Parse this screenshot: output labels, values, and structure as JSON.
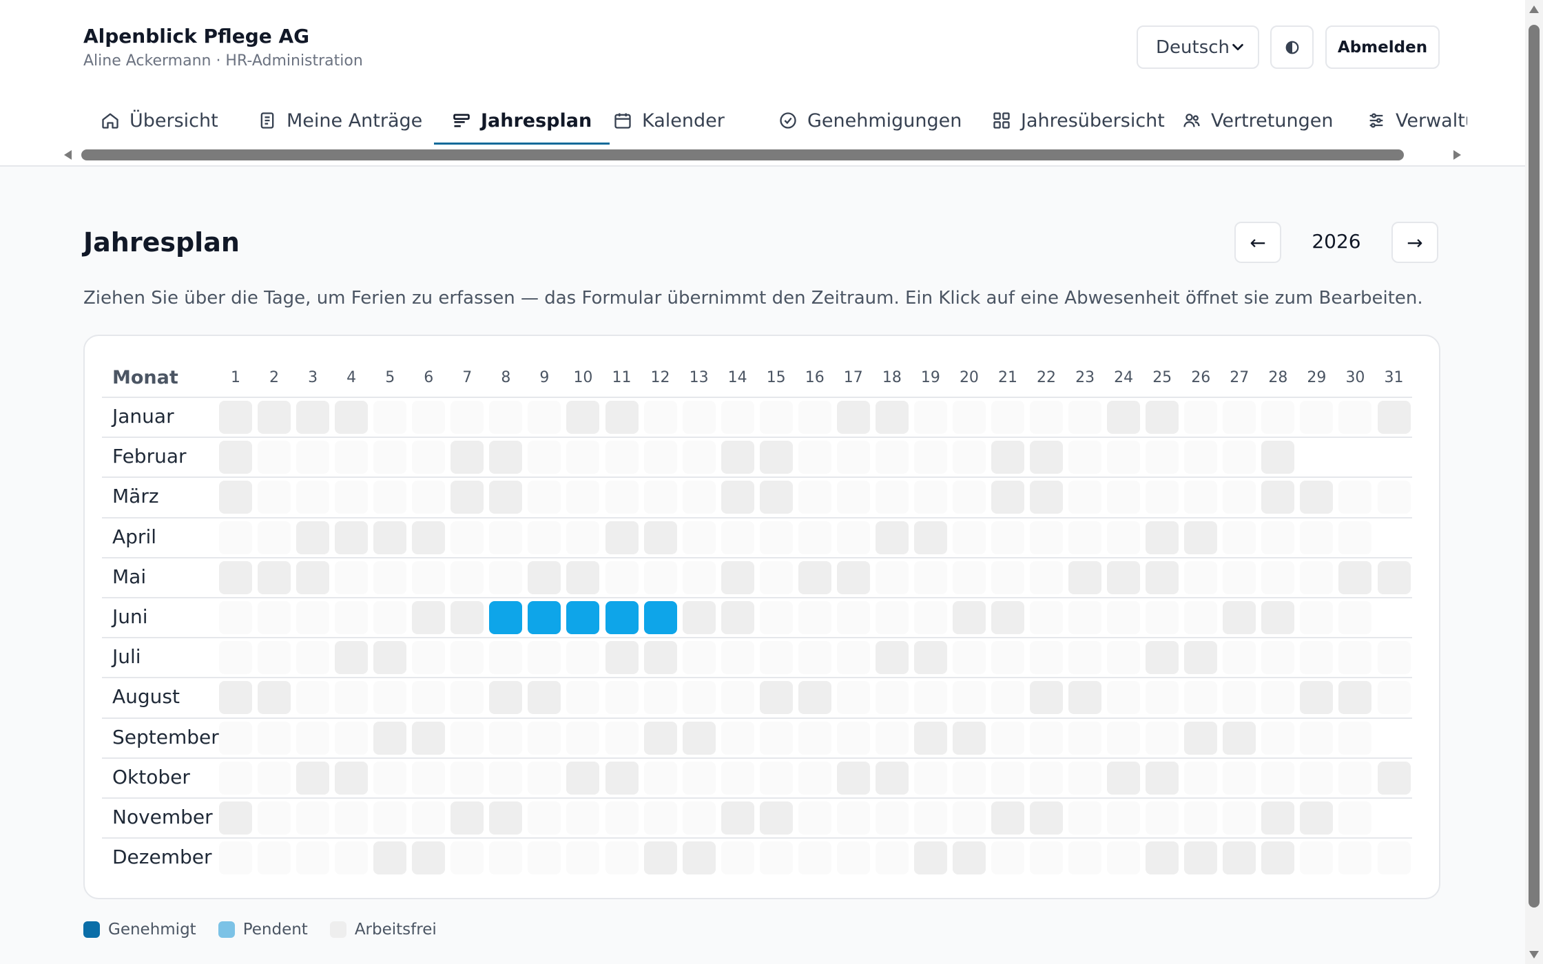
{
  "header": {
    "company": "Alpenblick Pflege AG",
    "user_line": "Aline Ackermann · HR-Administration",
    "language": "Deutsch",
    "logout_label": "Abmelden"
  },
  "tabs": [
    {
      "label": "Übersicht",
      "icon": "home-icon"
    },
    {
      "label": "Meine Anträge",
      "icon": "document-icon"
    },
    {
      "label": "Jahresplan",
      "icon": "timeline-icon",
      "active": true
    },
    {
      "label": "Kalender",
      "icon": "calendar-icon"
    },
    {
      "label": "Genehmigungen",
      "icon": "check-circle-icon"
    },
    {
      "label": "Jahresübersicht",
      "icon": "grid-icon"
    },
    {
      "label": "Vertretungen",
      "icon": "users-icon"
    },
    {
      "label": "Verwaltu",
      "icon": "sliders-icon"
    }
  ],
  "page": {
    "title": "Jahresplan",
    "year": "2026",
    "prev_label": "←",
    "next_label": "→",
    "hint": "Ziehen Sie über die Tage, um Ferien zu erfassen — das Formular übernimmt den Zeitraum. Ein Klick auf eine Abwesenheit öffnet sie zum Bearbeiten."
  },
  "grid": {
    "month_header": "Monat",
    "days": [
      "1",
      "2",
      "3",
      "4",
      "5",
      "6",
      "7",
      "8",
      "9",
      "10",
      "11",
      "12",
      "13",
      "14",
      "15",
      "16",
      "17",
      "18",
      "19",
      "20",
      "21",
      "22",
      "23",
      "24",
      "25",
      "26",
      "27",
      "28",
      "29",
      "30",
      "31"
    ],
    "months": [
      {
        "name": "Januar",
        "length": 31,
        "off": [
          1,
          2,
          3,
          4,
          10,
          11,
          17,
          18,
          24,
          25,
          31
        ],
        "approved": [],
        "pending": []
      },
      {
        "name": "Februar",
        "length": 28,
        "off": [
          1,
          7,
          8,
          14,
          15,
          21,
          22,
          28
        ],
        "approved": [],
        "pending": []
      },
      {
        "name": "März",
        "length": 31,
        "off": [
          1,
          7,
          8,
          14,
          15,
          21,
          22,
          28,
          29
        ],
        "approved": [],
        "pending": []
      },
      {
        "name": "April",
        "length": 30,
        "off": [
          3,
          4,
          5,
          6,
          11,
          12,
          18,
          19,
          25,
          26
        ],
        "approved": [],
        "pending": []
      },
      {
        "name": "Mai",
        "length": 31,
        "off": [
          1,
          2,
          3,
          9,
          10,
          14,
          16,
          17,
          23,
          24,
          25,
          30,
          31
        ],
        "approved": [],
        "pending": []
      },
      {
        "name": "Juni",
        "length": 30,
        "off": [
          6,
          7,
          13,
          14,
          20,
          21,
          27,
          28
        ],
        "approved": [
          8,
          9,
          10,
          11,
          12
        ],
        "pending": []
      },
      {
        "name": "Juli",
        "length": 31,
        "off": [
          4,
          5,
          11,
          12,
          18,
          19,
          25,
          26
        ],
        "approved": [],
        "pending": []
      },
      {
        "name": "August",
        "length": 31,
        "off": [
          1,
          2,
          8,
          9,
          15,
          16,
          22,
          23,
          29,
          30
        ],
        "approved": [],
        "pending": []
      },
      {
        "name": "September",
        "length": 30,
        "off": [
          5,
          6,
          12,
          13,
          19,
          20,
          26,
          27
        ],
        "approved": [],
        "pending": []
      },
      {
        "name": "Oktober",
        "length": 31,
        "off": [
          3,
          4,
          10,
          11,
          17,
          18,
          24,
          25,
          31
        ],
        "approved": [],
        "pending": []
      },
      {
        "name": "November",
        "length": 30,
        "off": [
          1,
          7,
          8,
          14,
          15,
          21,
          22,
          28,
          29
        ],
        "approved": [],
        "pending": []
      },
      {
        "name": "Dezember",
        "length": 31,
        "off": [
          5,
          6,
          12,
          13,
          19,
          20,
          25,
          26,
          27,
          28
        ],
        "approved": [],
        "pending": []
      }
    ]
  },
  "legend": [
    {
      "label": "Genehmigt",
      "color": "#0b6ea8"
    },
    {
      "label": "Pendent",
      "color": "#7cc2e6"
    },
    {
      "label": "Arbeitsfrei",
      "color": "#eeeeee"
    }
  ],
  "colors": {
    "approved": "#0ea5e9",
    "accent": "#0c6a99"
  }
}
